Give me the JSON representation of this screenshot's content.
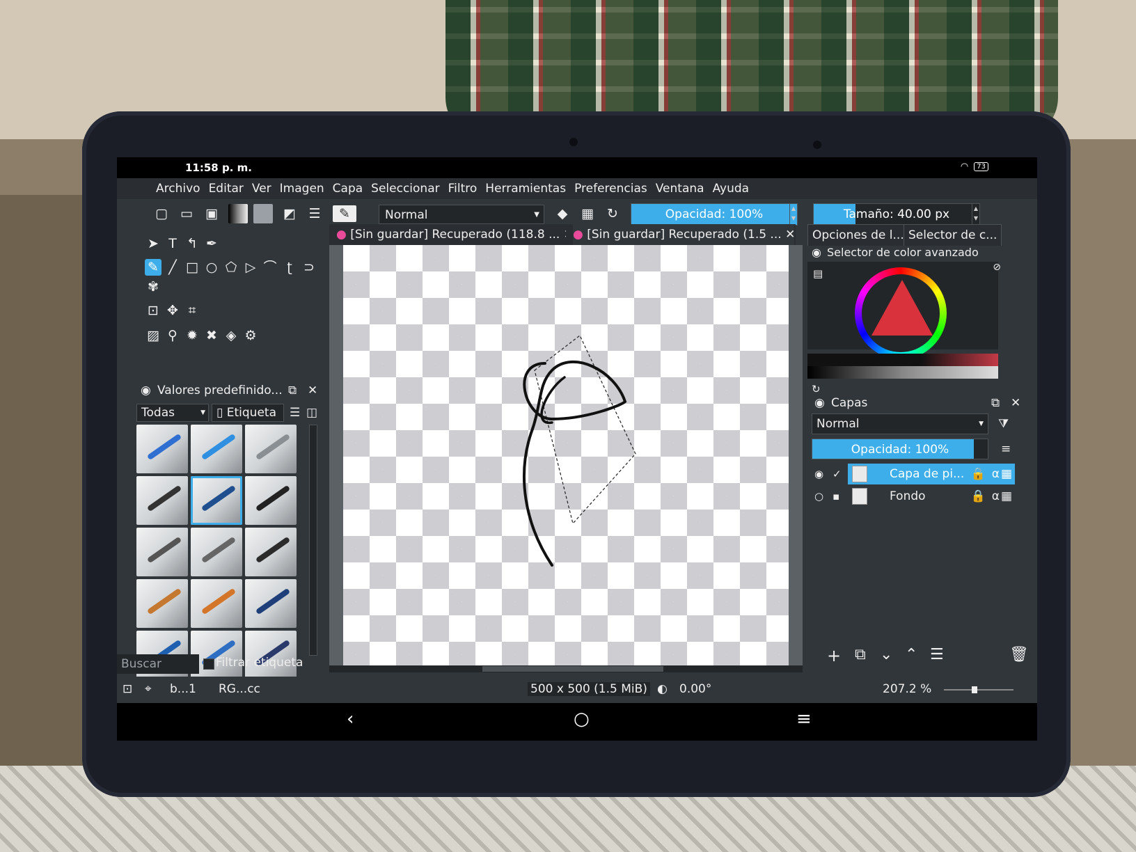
{
  "status_bar": {
    "time": "11:58 p. m.",
    "battery": "73"
  },
  "menu": [
    "Archivo",
    "Editar",
    "Ver",
    "Imagen",
    "Capa",
    "Seleccionar",
    "Filtro",
    "Herramientas",
    "Preferencias",
    "Ventana",
    "Ayuda"
  ],
  "toolbar": {
    "blend_mode": "Normal",
    "opacity_label": "Opacidad: 100%",
    "opacity": 1.0,
    "size_label": "Tamaño: 40.00 px",
    "size_fill": 0.25,
    "icons": [
      "new-document-icon",
      "open-document-icon",
      "save-icon",
      "gradient-icon",
      "pattern-icon",
      "color-swap-icon",
      "workspace-icon",
      "brush-preset-icon",
      "eraser-icon",
      "alpha-lock-icon",
      "reload-icon"
    ]
  },
  "tabs": [
    {
      "status": "[Sin guardar]",
      "title": "Recuperado (118.8 ..."
    },
    {
      "status": "[Sin guardar]",
      "title": "Recuperado (1.5 ..."
    }
  ],
  "presets": {
    "title": "Valores predefinido...",
    "filter": "Todas",
    "tag_button": "Etiqueta",
    "search_placeholder": "Buscar",
    "filter_tag_label": "Filtrar etiqueta",
    "items": [
      {
        "tool": "#2f6fd1"
      },
      {
        "tool": "#2f8fe1"
      },
      {
        "tool": "#8a8f93"
      },
      {
        "tool": "#333333"
      },
      {
        "tool": "#1f4f8f",
        "selected": true
      },
      {
        "tool": "#222222"
      },
      {
        "tool": "#555555"
      },
      {
        "tool": "#666666"
      },
      {
        "tool": "#2b2b2b"
      },
      {
        "tool": "#c5782f"
      },
      {
        "tool": "#d4762a"
      },
      {
        "tool": "#1e3f7a"
      },
      {
        "tool": "#1f5fb0"
      },
      {
        "tool": "#2e6fc4"
      },
      {
        "tool": "#2a3a6a"
      }
    ]
  },
  "right_panel": {
    "tab1": "Opciones de l...",
    "tab2": "Selector de c...",
    "color_selector_title": "Selector de color avanzado",
    "layers_title": "Capas",
    "layers_blend": "Normal",
    "layers_opacity_label": "Opacidad: 100%",
    "layers": [
      {
        "name": "Capa de pi...",
        "selected": true,
        "visible": true
      },
      {
        "name": "Fondo",
        "selected": false,
        "visible": false
      }
    ]
  },
  "app_status": {
    "brush": "b...1",
    "color_space": "RG...cc",
    "image_size": "500 x 500 (1.5 MiB)",
    "rotation": "0.00°",
    "zoom": "207.2 %"
  },
  "accent": "#3daee9"
}
